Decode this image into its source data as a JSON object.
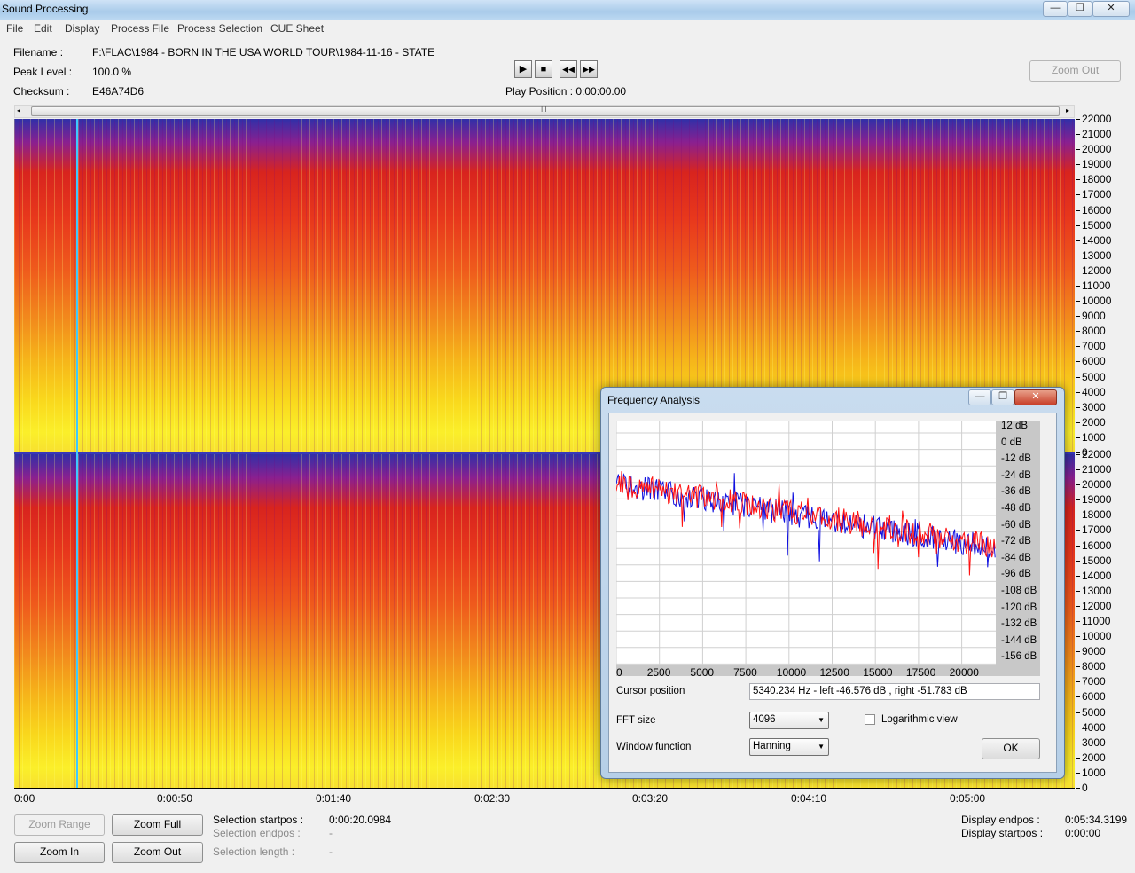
{
  "app": {
    "title": "Sound Processing",
    "window_controls": [
      "—",
      "❐",
      "✕"
    ]
  },
  "menu": [
    "File",
    "Edit",
    "Display",
    "Process File",
    "Process Selection",
    "CUE Sheet"
  ],
  "info": {
    "filename_label": "Filename :",
    "filename": "F:\\FLAC\\1984 - BORN IN THE USA WORLD TOUR\\1984-11-16 - STATE",
    "peak_label": "Peak Level :",
    "peak": "100.0 %",
    "checksum_label": "Checksum :",
    "checksum": "E46A74D6",
    "play_position": "Play Position : 0:00:00.00",
    "zoom_out_top": "Zoom Out"
  },
  "transport": {
    "play": "▶",
    "stop": "■",
    "rewind": "◀◀",
    "forward": "▶▶"
  },
  "scroll_grip": "III",
  "freq_axis": [
    "22000",
    "21000",
    "20000",
    "19000",
    "18000",
    "17000",
    "16000",
    "15000",
    "14000",
    "13000",
    "12000",
    "11000",
    "10000",
    "9000",
    "8000",
    "7000",
    "6000",
    "5000",
    "4000",
    "3000",
    "2000",
    "1000",
    "0"
  ],
  "time_axis": [
    "0:00",
    "0:00:50",
    "0:01:40",
    "0:02:30",
    "0:03:20",
    "0:04:10",
    "0:05:00"
  ],
  "buttons": {
    "zoom_range": "Zoom Range",
    "zoom_full": "Zoom Full",
    "zoom_in": "Zoom In",
    "zoom_out": "Zoom Out"
  },
  "selection": {
    "start_label": "Selection startpos :",
    "start_value": "0:00:20.0984",
    "end_label": "Selection endpos :",
    "end_value": "-",
    "length_label": "Selection length :",
    "length_value": "-"
  },
  "display": {
    "end_label": "Display endpos :",
    "end_value": "0:05:34.3199",
    "start_label": "Display startpos :",
    "start_value": "0:00:00"
  },
  "dialog": {
    "title": "Frequency Analysis",
    "db_labels": [
      "12 dB",
      "0 dB",
      "-12 dB",
      "-24 dB",
      "-36 dB",
      "-48 dB",
      "-60 dB",
      "-72 dB",
      "-84 dB",
      "-96 dB",
      "-108 dB",
      "-120 dB",
      "-132 dB",
      "-144 dB",
      "-156 dB"
    ],
    "x_labels": [
      "0",
      "2500",
      "5000",
      "7500",
      "10000",
      "12500",
      "15000",
      "17500",
      "20000"
    ],
    "cursor_label": "Cursor position",
    "cursor_value": "5340.234 Hz  -  left -46.576 dB , right -51.783 dB",
    "fft_label": "FFT size",
    "fft_value": "4096",
    "log_label": "Logarithmic view",
    "log_checked": false,
    "window_label": "Window function",
    "window_value": "Hanning",
    "ok": "OK",
    "colors": {
      "left": "#1010e0",
      "right": "#ff1010"
    }
  }
}
